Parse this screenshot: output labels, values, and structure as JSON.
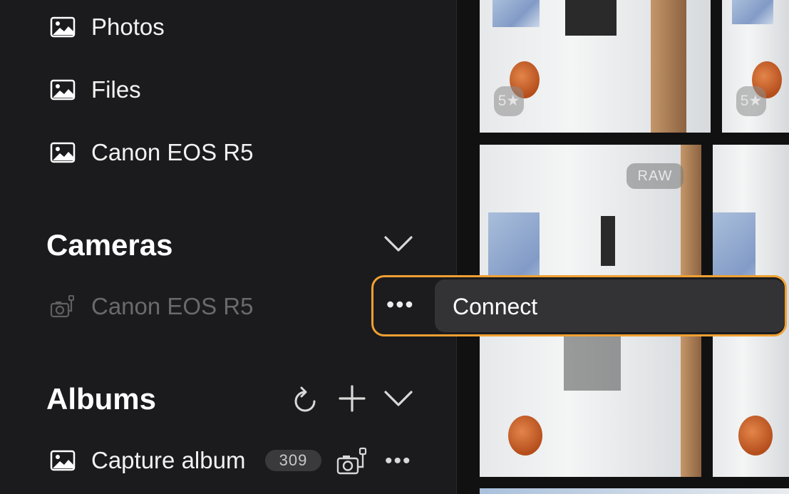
{
  "sidebar": {
    "sources": [
      {
        "label": "Photos",
        "icon": "image-icon"
      },
      {
        "label": "Files",
        "icon": "image-icon"
      },
      {
        "label": "Canon EOS R5",
        "icon": "image-icon"
      }
    ],
    "cameras": {
      "title": "Cameras",
      "items": [
        {
          "label": "Canon EOS R5",
          "icon": "tethered-camera-icon",
          "disabled": true
        }
      ]
    },
    "albums": {
      "title": "Albums",
      "items": [
        {
          "label": "Capture album",
          "count": "309",
          "icon": "image-icon"
        }
      ]
    },
    "more_symbol": "•••"
  },
  "grid": {
    "photos": [
      {
        "rating": "5★"
      },
      {
        "rating": "5★"
      },
      {
        "badge": "RAW"
      }
    ]
  },
  "popup": {
    "more_symbol": "•••",
    "action_label": "Connect"
  },
  "colors": {
    "accent": "#f0a033",
    "sidebar_bg": "#1b1b1d",
    "disabled_text": "#6a6a6d"
  }
}
